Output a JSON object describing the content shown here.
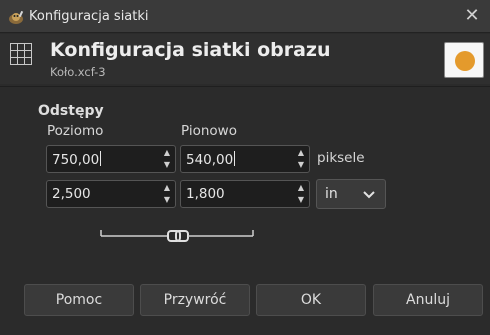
{
  "window": {
    "title": "Konfiguracja siatki",
    "close_glyph": "✕"
  },
  "header": {
    "title": "Konfiguracja siatki obrazu",
    "subtitle": "Koło.xcf-3",
    "icon": "grid-icon",
    "color_swatch": "#e49a2c"
  },
  "spacing": {
    "section_title": "Odstępy",
    "horizontal_label": "Poziomo",
    "vertical_label": "Pionowo",
    "pixels": {
      "horizontal": "750,00",
      "vertical": "540,00",
      "unit_label": "piksele"
    },
    "units": {
      "horizontal": "2,500",
      "vertical": "1,800",
      "selected_unit": "in"
    }
  },
  "buttons": {
    "help": "Pomoc",
    "reset": "Przywróć",
    "ok": "OK",
    "cancel": "Anuluj"
  },
  "colors": {
    "background": "#2b2b2b",
    "field": "#1e1e1e",
    "button": "#3a3a3a"
  }
}
